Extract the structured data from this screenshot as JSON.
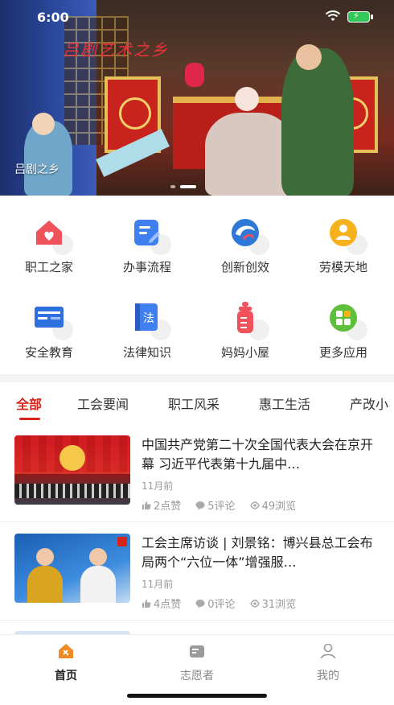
{
  "status_bar": {
    "time": "6:00"
  },
  "banner": {
    "calligraphy": "吕剧艺术之乡",
    "caption": "吕剧之乡",
    "slide_count": 2,
    "active_slide": 2
  },
  "quick_menu": [
    {
      "label": "职工之家",
      "icon": "home-icon",
      "color": "#f0525b"
    },
    {
      "label": "办事流程",
      "icon": "edit-document-icon",
      "color": "#3f7ff0"
    },
    {
      "label": "创新创效",
      "icon": "innovation-swirl-icon",
      "color": "#2f78d8"
    },
    {
      "label": "劳模天地",
      "icon": "model-worker-icon",
      "color": "#f5b21c"
    },
    {
      "label": "安全教育",
      "icon": "safety-board-icon",
      "color": "#2f6fe0"
    },
    {
      "label": "法律知识",
      "icon": "law-book-icon",
      "color": "#3f7ff0"
    },
    {
      "label": "妈妈小屋",
      "icon": "baby-bottle-icon",
      "color": "#f0525b"
    },
    {
      "label": "更多应用",
      "icon": "more-apps-icon",
      "color": "#5dbf3a"
    }
  ],
  "tabs": [
    {
      "label": "全部",
      "active": true
    },
    {
      "label": "工会要闻",
      "active": false
    },
    {
      "label": "职工风采",
      "active": false
    },
    {
      "label": "惠工生活",
      "active": false
    },
    {
      "label": "产改小",
      "active": false
    }
  ],
  "news": [
    {
      "title": "中国共产党第二十次全国代表大会在京开幕 习近平代表第十九届中…",
      "time": "11月前",
      "likes": "2点赞",
      "comments": "5评论",
      "views": "49浏览"
    },
    {
      "title": "工会主席访谈 | 刘景铭：博兴县总工会布局两个“六位一体”增强服…",
      "time": "11月前",
      "likes": "4点赞",
      "comments": "0评论",
      "views": "31浏览"
    }
  ],
  "bottom_nav": [
    {
      "label": "首页",
      "active": true
    },
    {
      "label": "志愿者",
      "active": false
    },
    {
      "label": "我的",
      "active": false
    }
  ],
  "colors": {
    "accent": "#d8231b",
    "muted": "#999999"
  }
}
